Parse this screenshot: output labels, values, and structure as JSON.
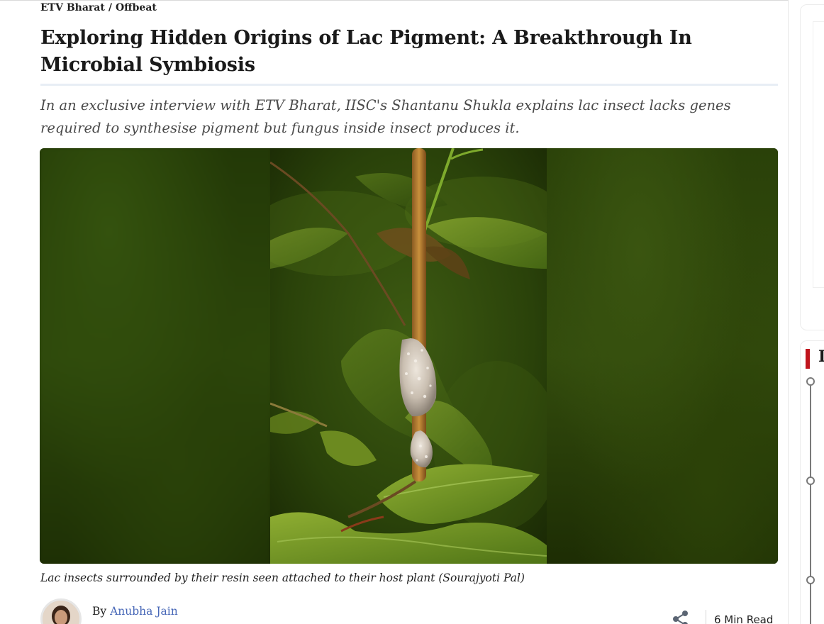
{
  "breadcrumb": {
    "site": "ETV Bharat",
    "separator": "/",
    "section": "Offbeat"
  },
  "article": {
    "title": "Exploring Hidden Origins of Lac Pigment: A Breakthrough In Microbial Symbiosis",
    "summary": "In an exclusive interview with ETV Bharat, IISC's Shantanu Shukla explains lac insect lacks genes required to synthesise pigment but fungus inside insect produces it.",
    "image_caption": "Lac insects surrounded by their resin seen attached to their host plant (Sourajyoti Pal)"
  },
  "byline": {
    "by_label": "By",
    "author": "Anubha Jain",
    "read_time": "6 Min Read",
    "share_icon": "share-icon"
  },
  "sidebar": {
    "heading_initial": "L"
  },
  "colors": {
    "accent_red": "#c0141c",
    "author_link": "#4767b7"
  }
}
